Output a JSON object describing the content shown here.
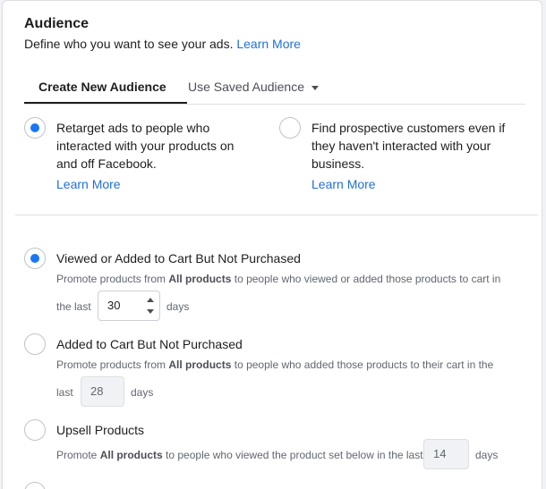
{
  "audience": {
    "title": "Audience",
    "subtitle": "Define who you want to see your ads.",
    "learn_more": "Learn More"
  },
  "tabs": {
    "create": "Create New Audience",
    "saved": "Use Saved Audience"
  },
  "targeting": {
    "retarget": {
      "line1": "Retarget ads to people who",
      "line2": "interacted with your products on",
      "line3": "and off Facebook.",
      "link": "Learn More",
      "selected": true
    },
    "prospect": {
      "line1": "Find prospective customers even if",
      "line2": "they haven't interacted with your",
      "line3": "business.",
      "link": "Learn More",
      "selected": false
    }
  },
  "options": {
    "viewed": {
      "title": "Viewed or Added to Cart But Not Purchased",
      "desc_pre": "Promote products from ",
      "desc_bold": "All products",
      "desc_post": " to people who viewed or added those products to cart in",
      "last": "the last",
      "days_value": "30",
      "days": "days",
      "selected": true
    },
    "added": {
      "title": "Added to Cart But Not Purchased",
      "desc_pre": "Promote products from ",
      "desc_bold": "All products",
      "desc_post": " to people who added those products to their cart in the",
      "last": "last",
      "days_value": "28",
      "days": "days",
      "selected": false
    },
    "upsell": {
      "title": "Upsell Products",
      "desc_pre": "Promote ",
      "desc_bold": "All products",
      "desc_post": " to people who viewed the product set below in the last",
      "days_value": "14",
      "days": "days",
      "selected": false
    }
  },
  "colors": {
    "accent": "#1877f2",
    "link": "#216fdb"
  }
}
